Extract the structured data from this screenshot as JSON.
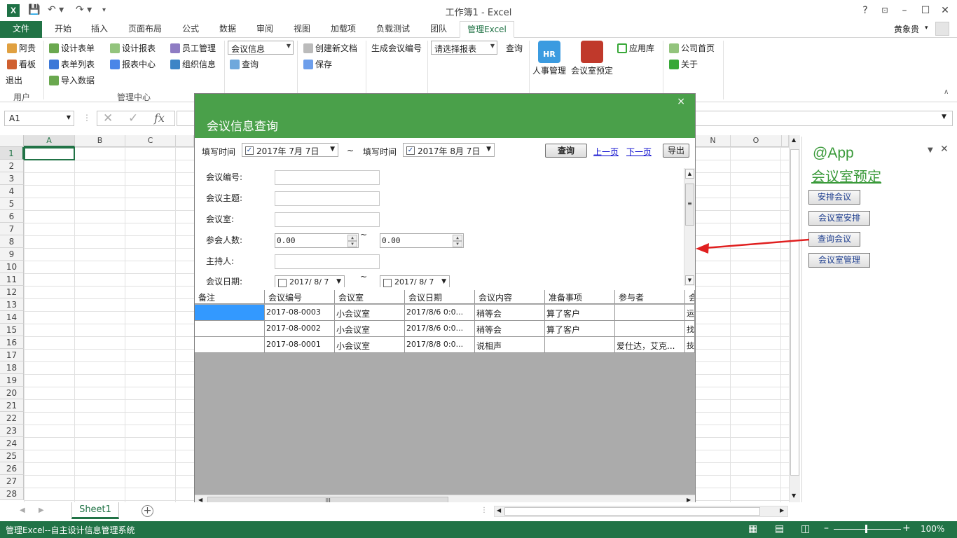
{
  "window": {
    "title": "工作簿1 - Excel",
    "help": "?",
    "user": "黄象贵"
  },
  "tabs": [
    "文件",
    "开始",
    "插入",
    "页面布局",
    "公式",
    "数据",
    "审阅",
    "视图",
    "加载项",
    "负载测试",
    "团队",
    "管理Excel"
  ],
  "ribbon": {
    "user_group": {
      "items": [
        "阿贵",
        "看板",
        "退出"
      ],
      "label": "用户"
    },
    "manage_group": {
      "items": [
        "设计表单",
        "表单列表",
        "导入数据",
        "设计报表",
        "报表中心",
        "员工管理",
        "组织信息"
      ],
      "label": "管理中心"
    },
    "combo1": "会议信息",
    "query1": "查询",
    "new_doc": "创建新文档",
    "save": "保存",
    "gen_no": "生成会议编号",
    "combo2": "请选择报表",
    "query2": "查询",
    "hr": "人事管理",
    "hr_logo": "HR",
    "room": "会议室预定",
    "appstore": "应用库",
    "home": "公司首页",
    "about": "关于"
  },
  "formula": {
    "namebox": "A1",
    "fx": "fx"
  },
  "grid": {
    "cols": [
      "A",
      "B",
      "C",
      "N",
      "O"
    ],
    "rows": [
      "1",
      "2",
      "3",
      "4",
      "5",
      "6",
      "7",
      "8",
      "9",
      "10",
      "11",
      "12",
      "13",
      "14",
      "15",
      "16",
      "17",
      "18",
      "19",
      "20",
      "21",
      "22",
      "23",
      "24",
      "25",
      "26",
      "27",
      "28"
    ]
  },
  "dialog": {
    "title": "会议信息查询",
    "close": "×",
    "fill_time_label": "填写时间",
    "from_date": "2017年 7月 7日",
    "tilde": "~",
    "to_date": "2017年 8月 7日",
    "query_btn": "查询",
    "prev": "上一页",
    "next": "下一页",
    "export": "导出",
    "fields": {
      "no": "会议编号:",
      "subject": "会议主题:",
      "room": "会议室:",
      "count": "参会人数:",
      "count_min": "0.00",
      "count_max": "0.00",
      "host": "主持人:",
      "date": "会议日期:",
      "date_from": "2017/ 8/ 7",
      "date_to": "2017/ 8/ 7"
    },
    "table": {
      "headers": [
        "备注",
        "会议编号",
        "会议室",
        "会议日期",
        "会议内容",
        "准备事项",
        "参与者",
        "会"
      ],
      "rows": [
        [
          "",
          "2017-08-0003",
          "小会议室",
          "2017/8/6 0:0...",
          "稍等会",
          "算了客户",
          "",
          "运"
        ],
        [
          "",
          "2017-08-0002",
          "小会议室",
          "2017/8/6 0:0...",
          "稍等会",
          "算了客户",
          "",
          "找"
        ],
        [
          "",
          "2017-08-0001",
          "小会议室",
          "2017/8/8 0:0...",
          "说相声",
          "",
          "爱仕达，艾克...",
          "技"
        ]
      ]
    }
  },
  "pane": {
    "app": "@App",
    "heading": "会议室预定",
    "buttons": [
      "安排会议",
      "会议室安排",
      "查询会议",
      "会议室管理"
    ]
  },
  "sheet": {
    "tab": "Sheet1"
  },
  "status": {
    "text": "管理Excel--自主设计信息管理系统",
    "zoom": "100%"
  },
  "colors": {
    "excel_green": "#217346",
    "dialog_green": "#4aa04a",
    "arrow_red": "#e02020"
  }
}
